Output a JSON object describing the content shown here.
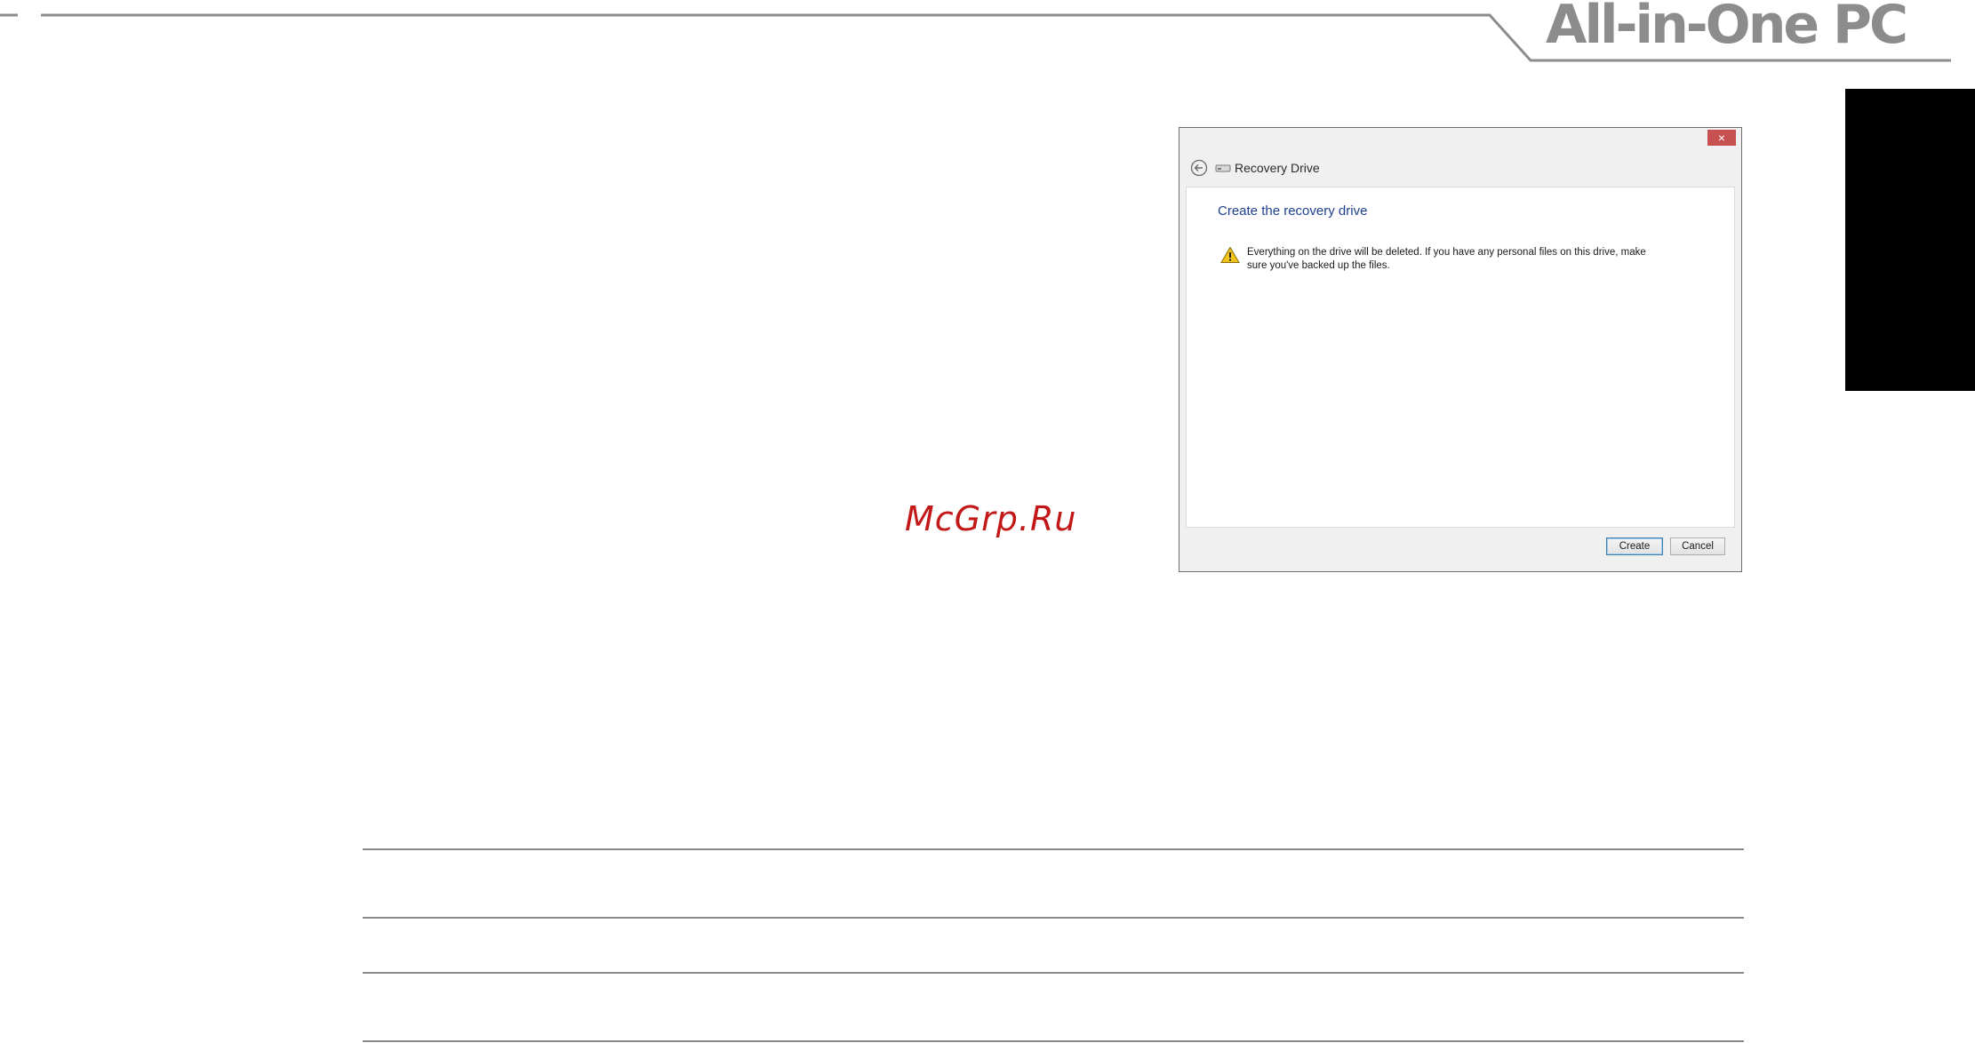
{
  "header": {
    "brand": "All-in-One PC"
  },
  "watermark": {
    "text": "McGrp.Ru"
  },
  "dialog": {
    "close_label": "×",
    "title": "Recovery Drive",
    "heading": "Create the recovery drive",
    "warning": "Everything on the drive will be deleted. If you have any personal files on this drive, make sure you've backed up the files.",
    "create_label": "Create",
    "cancel_label": "Cancel"
  },
  "icons": {
    "back": "back-arrow-icon",
    "drive": "drive-icon",
    "warning": "warning-icon",
    "close": "close-icon"
  },
  "colors": {
    "brand_gray": "#8c8c8c",
    "close_red": "#c75050",
    "heading_blue": "#1e3f8f",
    "watermark_red": "#c21818"
  }
}
